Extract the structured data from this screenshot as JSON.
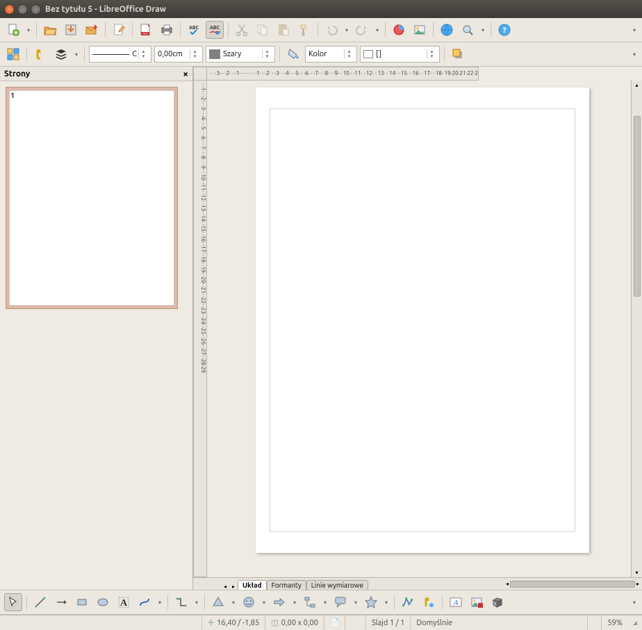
{
  "window": {
    "title": "Bez tytułu 5 - LibreOffice Draw"
  },
  "toolbar2": {
    "line_style": "C",
    "line_width": "0,00cm",
    "line_color_label": "Szary",
    "fill_type": "Kolor",
    "fill_color_label": "[]"
  },
  "panel": {
    "title": "Strony",
    "close": "×",
    "page_number": "1"
  },
  "ruler_h": "· · ·3· · ·2· · ·1· · · · · · ·1· · ·2· · ·3· · ·4· · ·5· · ·6· · ·7· · ·8· · ·9· · 10 · ·11· · 12· · 13· · 14· · 15· · 16· · 17· · 18· 19·20·21·22·2",
  "ruler_v": " · ·1· · ·2· · ·3· · ·4· · ·5· · ·6· · ·7· · ·8· · ·9· · 10· ·11· ·12· ·13· ·14· ·15· ·16· ·17· ·18· ·19· ·20· ·21· ·22· ·23· ·24· ·25· ·26· ·27· ·28·29",
  "tabs": {
    "t1": "Układ",
    "t2": "Formanty",
    "t3": "Linie wymiarowe"
  },
  "status": {
    "pos": "16,40 / -1,85",
    "size": "0,00 x 0,00",
    "slide": "Slajd 1 / 1",
    "style": "Domyślnie",
    "zoom": "59%"
  }
}
